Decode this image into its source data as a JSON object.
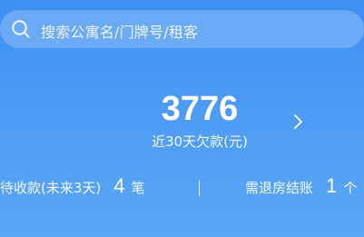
{
  "search": {
    "placeholder": "搜索公寓名/门牌号/租客",
    "icon": "search-icon"
  },
  "summary": {
    "amount": "3776",
    "label": "近30天欠款(元)",
    "detail_icon": "chevron-right-icon"
  },
  "stats": {
    "receivable": {
      "label": "待收款(未来3天)",
      "count": "4",
      "unit": "笔"
    },
    "checkout": {
      "label": "需退房结账",
      "count": "1",
      "unit": "个"
    }
  },
  "colors": {
    "background_top": "#3d8ff3",
    "background_bottom": "#5aa7f6",
    "text": "#ffffff"
  }
}
